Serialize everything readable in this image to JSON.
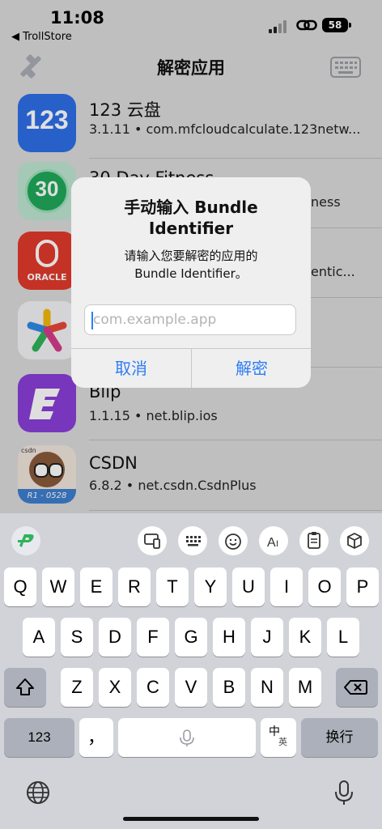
{
  "status": {
    "time": "11:08",
    "back_app": "◀ TrollStore",
    "battery": "58"
  },
  "nav": {
    "title": "解密应用",
    "wrench_icon": "wrench-icon",
    "keyboard_icon": "keyboard-icon"
  },
  "apps": [
    {
      "title": "123 云盘",
      "subtitle": "3.1.11 • com.mfcloudcalculate.123netw..."
    },
    {
      "title": "30 Day Fitness",
      "subtitle": "ness"
    },
    {
      "title": "",
      "subtitle": "entic..."
    },
    {
      "title": "",
      "subtitle": ""
    },
    {
      "title": "Blip",
      "subtitle": "1.1.15 • net.blip.ios"
    },
    {
      "title": "CSDN",
      "subtitle": "6.8.2 • net.csdn.CsdnPlus"
    }
  ],
  "icon_labels": {
    "app1": "123",
    "app2": "30",
    "app3": "ORACLE",
    "app6_badge": "R1 - 0528",
    "app6_logo": "csdn"
  },
  "dialog": {
    "title_line1": "手动输入 Bundle",
    "title_line2": "Identifier",
    "message_line1": "请输入您要解密的应用的",
    "message_line2": "Bundle Identifier。",
    "input_placeholder": "com.example.app",
    "cancel": "取消",
    "confirm": "解密"
  },
  "keyboard": {
    "row1": [
      "Q",
      "W",
      "E",
      "R",
      "T",
      "Y",
      "U",
      "I",
      "O",
      "P"
    ],
    "row2": [
      "A",
      "S",
      "D",
      "F",
      "G",
      "H",
      "J",
      "K",
      "L"
    ],
    "row3": [
      "Z",
      "X",
      "C",
      "V",
      "B",
      "N",
      "M"
    ],
    "num": "123",
    "punct": "，",
    "lang_top": "中",
    "lang_bottom": "英",
    "return": "换行"
  },
  "colors": {
    "accent": "#2f7cf6",
    "app1": "#2e6fe8",
    "app3": "#e23a2b",
    "app5": "#8a3ed8"
  }
}
